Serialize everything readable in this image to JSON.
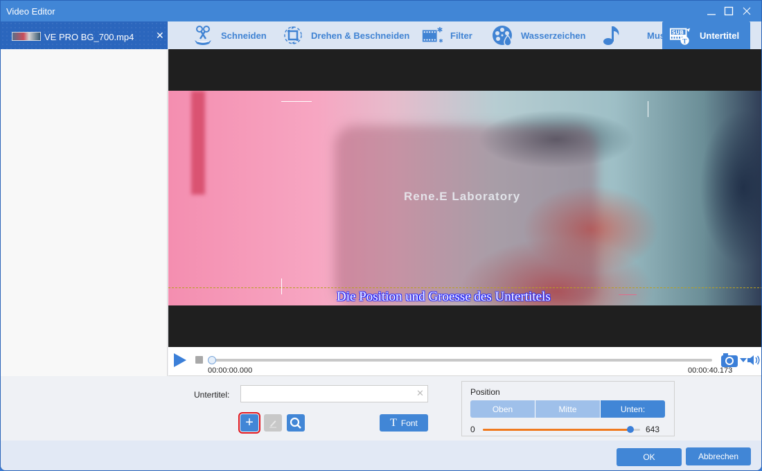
{
  "window": {
    "title": "Video Editor"
  },
  "file_tab": {
    "filename": "VE PRO BG_700.mp4",
    "close_glyph": "✕"
  },
  "tabs": [
    {
      "label": "Schneiden",
      "icon": "scissors-icon"
    },
    {
      "label": "Drehen & Beschneiden",
      "icon": "rotate-crop-icon"
    },
    {
      "label": "Filter",
      "icon": "filter-film-icon"
    },
    {
      "label": "Wasserzeichen",
      "icon": "watermark-reel-icon"
    },
    {
      "label": "Musik",
      "icon": "music-note-icon"
    },
    {
      "label": "Untertitel",
      "icon": "subtitle-icon",
      "active": true
    }
  ],
  "preview": {
    "watermark_text": "Rene.E Laboratory",
    "subtitle_text": "Die Position und Groesse des Untertitels"
  },
  "player": {
    "time_current": "00:00:00.000",
    "time_total": "00:00:40.173",
    "progress": 0
  },
  "subtitle_panel": {
    "label": "Untertitel:",
    "input_value": "",
    "input_placeholder": "",
    "clear_glyph": "✕",
    "add_glyph": "+",
    "font_button_glyph": "T",
    "font_button_label": "Font"
  },
  "position_panel": {
    "title": "Position",
    "options": [
      "Oben",
      "Mitte",
      "Unten:"
    ],
    "selected": "Unten:",
    "slider_min": "0",
    "slider_max": "643",
    "slider_value_fraction": 0.94
  },
  "footer": {
    "ok_label": "OK",
    "cancel_label": "Abbrechen"
  },
  "colors": {
    "accent": "#4186d6",
    "titlebar": "#4186d6",
    "slider_fill": "#f07a1e",
    "highlight_outline": "#e0161d"
  }
}
